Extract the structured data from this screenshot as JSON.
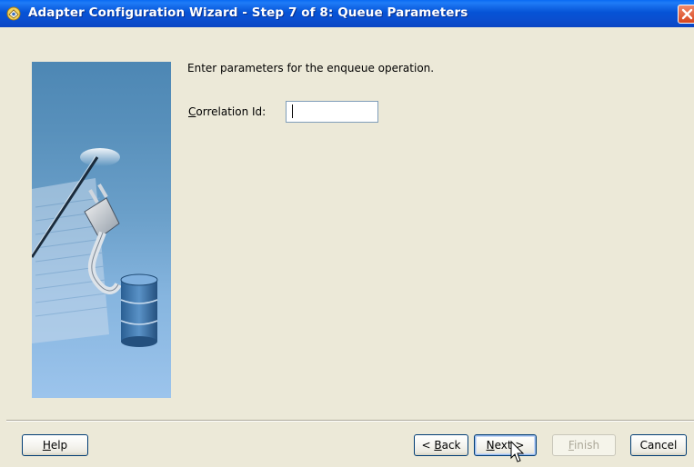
{
  "window": {
    "title": "Adapter Configuration Wizard - Step 7 of 8: Queue Parameters",
    "close_icon": "close-icon"
  },
  "main": {
    "instruction": "Enter parameters for the enqueue operation.",
    "correlation_id": {
      "label_first_char": "C",
      "label_rest": "orrelation Id:",
      "value": ""
    }
  },
  "buttons": {
    "help": {
      "ul": "H",
      "rest": "elp"
    },
    "back": {
      "pre": "< ",
      "ul": "B",
      "rest": "ack"
    },
    "next": {
      "pre": "",
      "ul": "N",
      "rest": "ext >"
    },
    "finish": {
      "ul": "F",
      "rest": "inish"
    },
    "cancel": {
      "label": "Cancel"
    }
  },
  "colors": {
    "titlebar": "#0a5ae0",
    "close": "#d6451e",
    "dialog_bg": "#ece9d8",
    "field_border": "#7f9db9"
  }
}
